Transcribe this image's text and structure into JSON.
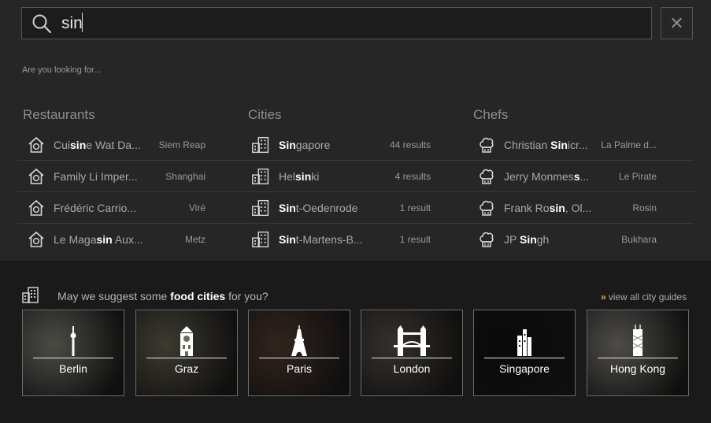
{
  "search": {
    "value": "sin",
    "placeholder": ""
  },
  "hint": "Are you looking for...",
  "columns": {
    "restaurants": {
      "title": "Restaurants",
      "items": [
        {
          "pre": "Cui",
          "match": "sin",
          "post": "e Wat Da...",
          "meta": "Siem Reap"
        },
        {
          "pre": "Family Li Imper...",
          "match": "",
          "post": "",
          "meta": "Shanghai"
        },
        {
          "pre": "Frédéric Carrio...",
          "match": "",
          "post": "",
          "meta": "Viré"
        },
        {
          "pre": "Le Maga",
          "match": "sin",
          "post": " Aux...",
          "meta": "Metz"
        }
      ]
    },
    "cities": {
      "title": "Cities",
      "items": [
        {
          "pre": "",
          "match": "Sin",
          "post": "gapore",
          "meta": "44 results"
        },
        {
          "pre": "Hel",
          "match": "sin",
          "post": "ki",
          "meta": "4 results"
        },
        {
          "pre": "",
          "match": "Sin",
          "post": "t-Oedenrode",
          "meta": "1 result"
        },
        {
          "pre": "",
          "match": "Sin",
          "post": "t-Martens-B...",
          "meta": "1 result"
        }
      ]
    },
    "chefs": {
      "title": "Chefs",
      "items": [
        {
          "pre": "Christian ",
          "match": "Sin",
          "post": "icr...",
          "meta": "La Palme d..."
        },
        {
          "pre": "Jerry Monmes",
          "match": "s",
          "post": "...",
          "meta": "Le Pirate"
        },
        {
          "pre": "Frank Ro",
          "match": "sin",
          "post": ", Ol...",
          "meta": "Rosin"
        },
        {
          "pre": "JP ",
          "match": "Sin",
          "post": "gh",
          "meta": "Bukhara"
        }
      ]
    }
  },
  "suggest": {
    "pre": "May we suggest some ",
    "bold": "food cities",
    "post": " for you?"
  },
  "view_all": {
    "chevron": "»",
    "label": "view all city guides"
  },
  "city_cards": [
    {
      "name": "Berlin",
      "icon": "tv-tower-icon",
      "bg": "#8a8a80"
    },
    {
      "name": "Graz",
      "icon": "clock-tower-icon",
      "bg": "#6e6b58"
    },
    {
      "name": "Paris",
      "icon": "eiffel-tower-icon",
      "bg": "#5a4236"
    },
    {
      "name": "London",
      "icon": "tower-bridge-icon",
      "bg": "#625850"
    },
    {
      "name": "Singapore",
      "icon": "skyline-icon",
      "bg": "#111111"
    },
    {
      "name": "Hong Kong",
      "icon": "bank-tower-icon",
      "bg": "#8d8c84"
    }
  ],
  "colors": {
    "accent": "#e2b043",
    "panel": "#262626",
    "background": "#1a1a1a",
    "match": "#ffffff"
  }
}
